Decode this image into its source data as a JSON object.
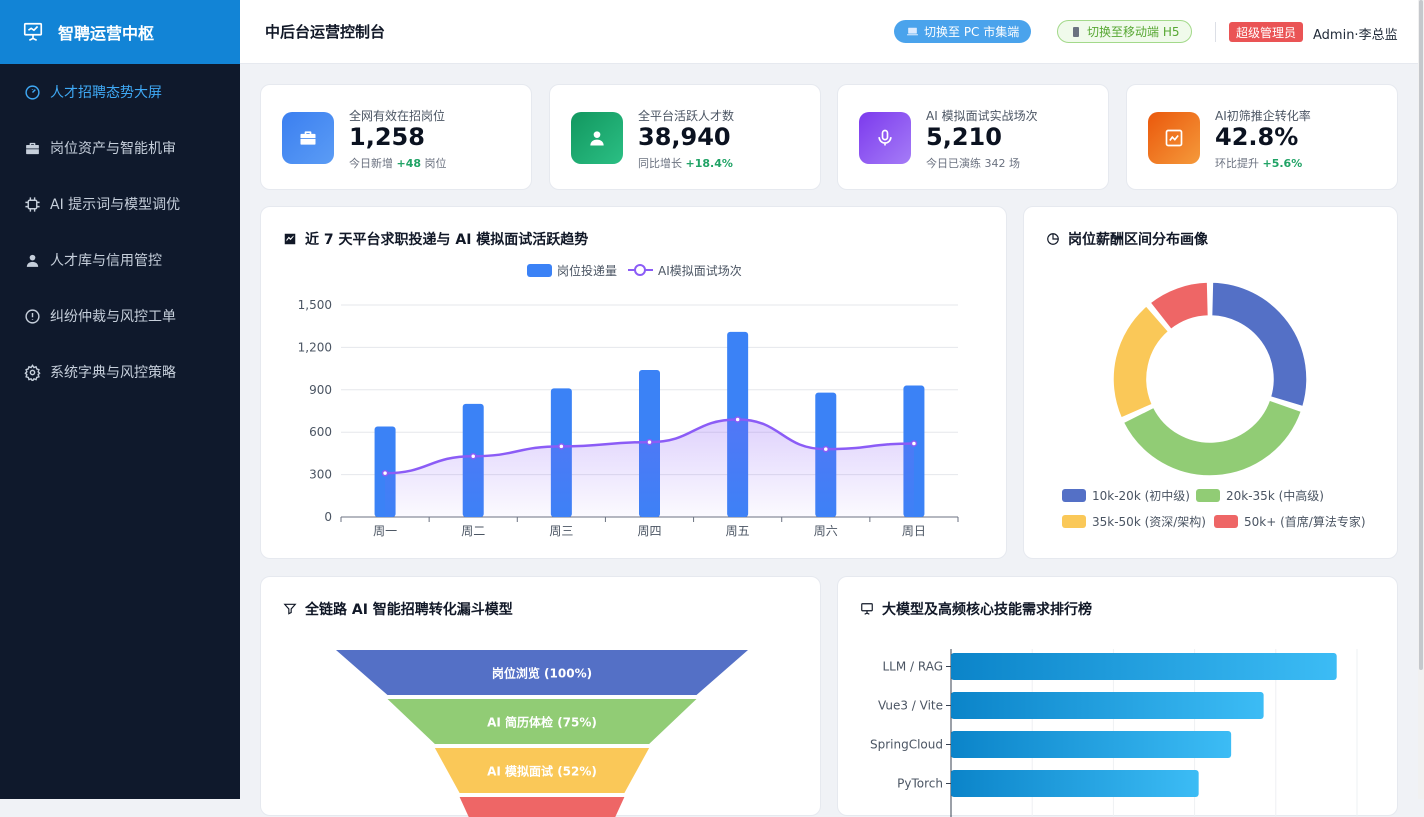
{
  "brand": {
    "title": "智聘运营中枢"
  },
  "sidebar": {
    "items": [
      {
        "label": "人才招聘态势大屏",
        "icon": "dashboard-icon",
        "active": true
      },
      {
        "label": "岗位资产与智能机审",
        "icon": "briefcase-icon"
      },
      {
        "label": "AI 提示词与模型调优",
        "icon": "chip-icon"
      },
      {
        "label": "人才库与信用管控",
        "icon": "user-icon"
      },
      {
        "label": "纠纷仲裁与风控工单",
        "icon": "warning-icon"
      },
      {
        "label": "系统字典与风控策略",
        "icon": "gear-icon"
      }
    ]
  },
  "header": {
    "title": "中后台运营控制台",
    "switch_pc": "切换至 PC 市集端",
    "switch_h5": "切换至移动端 H5",
    "role_badge": "超级管理员",
    "user_name": "Admin·李总监"
  },
  "kpis": [
    {
      "label": "全网有效在招岗位",
      "value": "1,258",
      "sub_text": "今日新增",
      "sub_value": "+48",
      "sub_unit": "岗位",
      "icon": "briefcase-icon",
      "color": "#3b7ff0"
    },
    {
      "label": "全平台活跃人才数",
      "value": "38,940",
      "sub_text": "同比增长",
      "sub_value": "+18.4%",
      "sub_unit": "",
      "icon": "user-icon",
      "color": "#16a06a"
    },
    {
      "label": "AI 模拟面试实战场次",
      "value": "5,210",
      "sub_text": "今日已演练",
      "sub_value": "342",
      "sub_unit": "场",
      "icon": "microphone-icon",
      "color": "#8b5cf6"
    },
    {
      "label": "AI初筛推企转化率",
      "value": "42.8%",
      "sub_text": "环比提升",
      "sub_value": "+5.6%",
      "sub_unit": "",
      "icon": "trend-icon",
      "color": "#f07a1a"
    }
  ],
  "colors": {
    "brand": "#1284d6",
    "sidebar_bg": "#0f192c",
    "active": "#3fa9f5"
  },
  "chart_data": [
    {
      "type": "bar",
      "title": "近 7 天平台求职投递与 AI 模拟面试活跃趋势",
      "categories": [
        "周一",
        "周二",
        "周三",
        "周四",
        "周五",
        "周六",
        "周日"
      ],
      "series": [
        {
          "name": "岗位投递量",
          "type": "bar",
          "values": [
            640,
            800,
            910,
            1040,
            1310,
            880,
            930
          ],
          "color": "#3b82f6"
        },
        {
          "name": "AI模拟面试场次",
          "type": "line",
          "values": [
            310,
            430,
            500,
            530,
            690,
            480,
            520
          ],
          "color": "#8b5cf6"
        }
      ],
      "yticks": [
        "0",
        "300",
        "600",
        "900",
        "1,200",
        "1,500"
      ],
      "ylim": [
        0,
        1500
      ],
      "grid": true,
      "legend": "top-center"
    },
    {
      "type": "pie",
      "title": "岗位薪酬区间分布画像",
      "slices": [
        {
          "label": "10k-20k (初中级)",
          "value": 30,
          "color": "#5470c6"
        },
        {
          "label": "20k-35k (中高级)",
          "value": 38,
          "color": "#91cc75"
        },
        {
          "label": "35k-50k (资深/架构)",
          "value": 21,
          "color": "#fac858"
        },
        {
          "label": "50k+ (首席/算法专家)",
          "value": 11,
          "color": "#ee6666"
        }
      ],
      "legend": "bottom"
    },
    {
      "type": "bar",
      "title": "全链路 AI 智能招聘转化漏斗模型",
      "subtype": "funnel",
      "stages": [
        {
          "label": "岗位浏览 (100%)",
          "value": 100,
          "color": "#5470c6"
        },
        {
          "label": "AI 简历体检 (75%)",
          "value": 75,
          "color": "#91cc75"
        },
        {
          "label": "AI 模拟面试 (52%)",
          "value": 52,
          "color": "#fac858"
        },
        {
          "label": "",
          "value": 40,
          "color": "#ee6666"
        }
      ]
    },
    {
      "type": "bar",
      "title": "大模型及高频核心技能需求排行榜",
      "orientation": "horizontal",
      "categories": [
        "LLM / RAG",
        "Vue3 / Vite",
        "SpringCloud",
        "PyTorch"
      ],
      "values": [
        95,
        77,
        69,
        61
      ],
      "xlim": [
        0,
        100
      ]
    }
  ]
}
